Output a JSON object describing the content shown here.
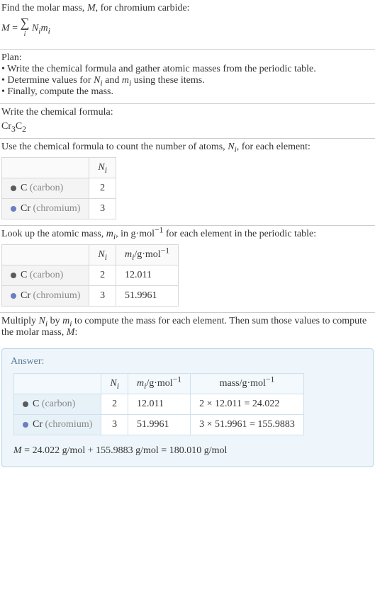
{
  "intro": {
    "line1": "Find the molar mass, M, for chromium carbide:",
    "formula_lhs": "M",
    "formula_eq": "=",
    "formula_sum": "∑",
    "formula_sum_idx": "i",
    "formula_rhs_N": "N",
    "formula_rhs_i1": "i",
    "formula_rhs_m": "m",
    "formula_rhs_i2": "i"
  },
  "plan": {
    "heading": "Plan:",
    "b1": "• Write the chemical formula and gather atomic masses from the periodic table.",
    "b2_a": "• Determine values for ",
    "b2_N": "N",
    "b2_i1": "i",
    "b2_and": " and ",
    "b2_m": "m",
    "b2_i2": "i",
    "b2_b": " using these items.",
    "b3": "• Finally, compute the mass."
  },
  "chem": {
    "heading": "Write the chemical formula:",
    "e1": "Cr",
    "s1": "3",
    "e2": "C",
    "s2": "2"
  },
  "count": {
    "heading_a": "Use the chemical formula to count the number of atoms, ",
    "heading_N": "N",
    "heading_i": "i",
    "heading_b": ", for each element:",
    "col_N": "N",
    "col_i": "i",
    "rows": [
      {
        "sym": "C",
        "name": "(carbon)",
        "n": "2"
      },
      {
        "sym": "Cr",
        "name": "(chromium)",
        "n": "3"
      }
    ]
  },
  "lookup": {
    "heading_a": "Look up the atomic mass, ",
    "heading_m": "m",
    "heading_i": "i",
    "heading_b": ", in g·mol",
    "heading_exp": "−1",
    "heading_c": " for each element in the periodic table:",
    "col_N": "N",
    "col_Ni": "i",
    "col_m": "m",
    "col_mi": "i",
    "col_unit": "/g·mol",
    "col_exp": "−1",
    "rows": [
      {
        "sym": "C",
        "name": "(carbon)",
        "n": "2",
        "m": "12.011"
      },
      {
        "sym": "Cr",
        "name": "(chromium)",
        "n": "3",
        "m": "51.9961"
      }
    ]
  },
  "mult": {
    "line_a": "Multiply ",
    "N": "N",
    "i1": "i",
    "by": " by ",
    "m": "m",
    "i2": "i",
    "line_b": " to compute the mass for each element. Then sum those values to compute the molar mass, ",
    "M": "M",
    "colon": ":"
  },
  "answer": {
    "label": "Answer:",
    "col_N": "N",
    "col_Ni": "i",
    "col_m": "m",
    "col_mi": "i",
    "col_munit": "/g·mol",
    "col_mexp": "−1",
    "col_mass": "mass/g·mol",
    "col_massexp": "−1",
    "rows": [
      {
        "sym": "C",
        "name": "(carbon)",
        "n": "2",
        "m": "12.011",
        "calc": "2 × 12.011 = 24.022"
      },
      {
        "sym": "Cr",
        "name": "(chromium)",
        "n": "3",
        "m": "51.9961",
        "calc": "3 × 51.9961 = 155.9883"
      }
    ],
    "final_M": "M",
    "final_eq": " = 24.022 g/mol + 155.9883 g/mol = 180.010 g/mol"
  }
}
